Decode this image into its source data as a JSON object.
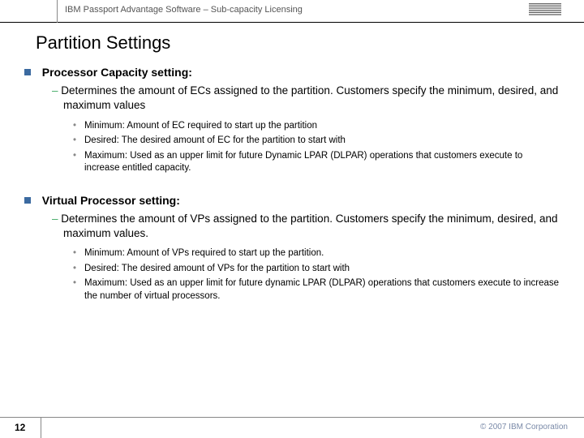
{
  "header": {
    "breadcrumb": "IBM Passport Advantage Software – Sub-capacity Licensing",
    "logo_name": "ibm-logo"
  },
  "title": "Partition Settings",
  "sections": [
    {
      "heading": "Processor Capacity setting:",
      "dash": "Determines the amount of ECs assigned to the partition. Customers specify the minimum, desired, and maximum values",
      "sub": [
        "Minimum: Amount of EC required to start up the partition",
        "Desired: The desired amount of EC for the partition to start with",
        "Maximum:  Used as an upper limit for future Dynamic LPAR (DLPAR) operations that customers execute to increase entitled capacity."
      ]
    },
    {
      "heading": "Virtual Processor setting:",
      "dash": "Determines the amount of VPs assigned to the partition. Customers specify the minimum, desired, and maximum values.",
      "sub": [
        "Minimum: Amount of VPs required to start up the partition.",
        "Desired: The desired amount of VPs for the partition to start with",
        "Maximum:  Used as an upper limit for future dynamic LPAR (DLPAR) operations that customers execute to increase the number of virtual processors."
      ]
    }
  ],
  "footer": {
    "page": "12",
    "copyright": "© 2007 IBM Corporation"
  }
}
